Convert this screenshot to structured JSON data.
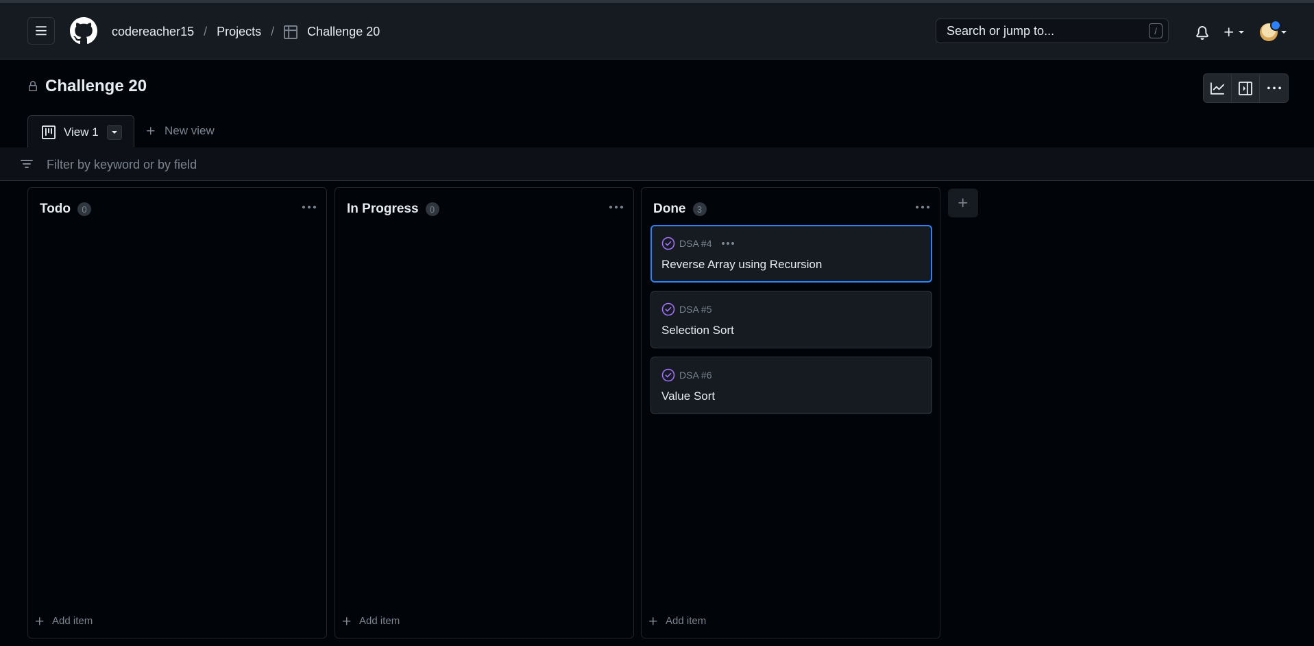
{
  "header": {
    "breadcrumb": {
      "owner": "codereacher15",
      "section": "Projects",
      "project": "Challenge 20"
    },
    "search": {
      "placeholder": "Search or jump to...",
      "shortcut": "/"
    },
    "icons": [
      "menu-icon",
      "github-logo",
      "table-icon",
      "bell-icon",
      "plus-icon",
      "avatar"
    ]
  },
  "project": {
    "title": "Challenge 20",
    "actions": [
      "insights-icon",
      "side-panel-icon",
      "more-options-icon"
    ]
  },
  "tabs": {
    "active_label": "View 1",
    "new_view_label": "New view"
  },
  "filter": {
    "placeholder": "Filter by keyword or by field"
  },
  "columns": [
    {
      "title": "Todo",
      "count": "0",
      "add_label": "Add item",
      "cards": []
    },
    {
      "title": "In Progress",
      "count": "0",
      "add_label": "Add item",
      "cards": []
    },
    {
      "title": "Done",
      "count": "3",
      "add_label": "Add item",
      "cards": [
        {
          "ref": "DSA #4",
          "title": "Reverse Array using Recursion",
          "selected": true
        },
        {
          "ref": "DSA #5",
          "title": "Selection Sort"
        },
        {
          "ref": "DSA #6",
          "title": "Value Sort"
        }
      ]
    }
  ],
  "colors": {
    "accent": "#2f81f7",
    "done_purple": "#a371f7",
    "background": "#010409"
  }
}
